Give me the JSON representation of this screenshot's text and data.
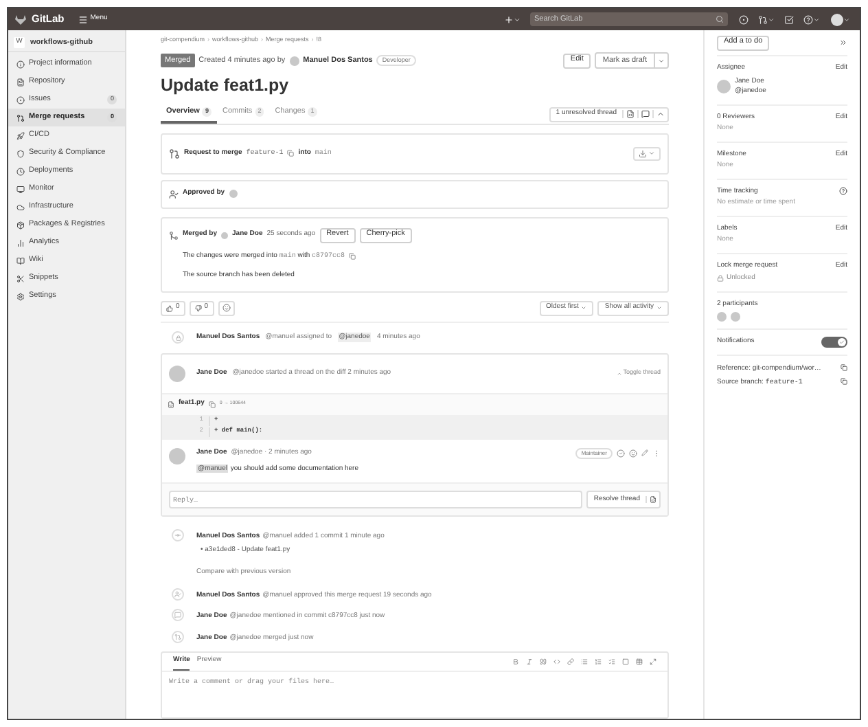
{
  "topbar": {
    "logo": "GitLab",
    "menu": "Menu",
    "search": {
      "placeholder": "Search GitLab"
    }
  },
  "sidebar": {
    "project": {
      "initial": "W",
      "name": "workflows-github"
    },
    "items": [
      {
        "label": "Project information",
        "selected": false
      },
      {
        "label": "Repository",
        "selected": false
      },
      {
        "label": "Issues",
        "badge": "0",
        "selected": false
      },
      {
        "label": "Merge requests",
        "badge": "0",
        "selected": true
      },
      {
        "label": "CI/CD",
        "selected": false
      },
      {
        "label": "Security & Compliance",
        "selected": false
      },
      {
        "label": "Deployments",
        "selected": false
      },
      {
        "label": "Monitor",
        "selected": false
      },
      {
        "label": "Infrastructure",
        "selected": false
      },
      {
        "label": "Packages & Registries",
        "selected": false
      },
      {
        "label": "Analytics",
        "selected": false
      },
      {
        "label": "Wiki",
        "selected": false
      },
      {
        "label": "Snippets",
        "selected": false
      },
      {
        "label": "Settings",
        "selected": false
      }
    ]
  },
  "breadcrumbs": {
    "separator": "›",
    "items": [
      "git-compendium",
      "workflows-github",
      "Merge requests",
      "!8"
    ]
  },
  "header": {
    "status": "Merged",
    "created": "Created 4 minutes ago by",
    "author": "Manuel Dos Santos",
    "role": "Developer",
    "buttons": [
      "Edit",
      "Mark as draft"
    ],
    "title": "Update feat1.py"
  },
  "tabs": [
    {
      "label": "Overview",
      "count": "9",
      "selected": true
    },
    {
      "label": "Commits",
      "count": "2",
      "selected": false
    },
    {
      "label": "Changes",
      "count": "1",
      "selected": false
    }
  ],
  "threads": "1 unresolved thread",
  "request": {
    "label": "Request to merge",
    "source": "feature-1",
    "into": "into",
    "target": "main"
  },
  "approval": {
    "label": "Approved by"
  },
  "merged": {
    "label": "Merged by",
    "user": "Jane Doe",
    "time": "25 seconds ago",
    "buttons": [
      "Revert",
      "Cherry-pick"
    ],
    "text": "The changes were merged into",
    "branch": "main",
    "with": "with",
    "commit": "c8797cc8",
    "deleted": "The source branch has been deleted"
  },
  "reactions": [
    {
      "kind": "up",
      "count": "0"
    },
    {
      "kind": "down",
      "count": "0"
    }
  ],
  "sort": [
    "Oldest first",
    "Show all activity"
  ],
  "assigned": {
    "author": "Manuel Dos Santos",
    "handle": "@manuel",
    "text": "assigned to",
    "mention": "@janedoe",
    "time": "4 minutes ago"
  },
  "thread": {
    "author": "Jane Doe",
    "handle": "@janedoe",
    "text": "started a thread on the diff 2 minutes ago",
    "toggle": "Toggle thread",
    "file": "feat1.py",
    "mode": "0 → 100644",
    "lines": [
      {
        "number": "1",
        "code": "+"
      },
      {
        "number": "2",
        "code": "+ def main():"
      }
    ],
    "comment": {
      "author": "Jane Doe",
      "meta": "@janedoe · 2 minutes ago",
      "role": "Maintainer",
      "mention": "@manuel",
      "text": "you should add some documentation here"
    },
    "reply": {
      "placeholder": "Reply…"
    },
    "resolve": "Resolve thread"
  },
  "events": [
    {
      "kind": "commit",
      "author": "Manuel Dos Santos",
      "text": "@manuel added 1 commit 1 minute ago",
      "commit": "• a3e1ded8 - Update feat1.py",
      "link": "Compare with previous version"
    },
    {
      "kind": "approved",
      "author": "Manuel Dos Santos",
      "text": "@manuel approved this merge request 19 seconds ago"
    },
    {
      "kind": "mention",
      "author": "Jane Doe",
      "text": "@janedoe mentioned in commit c8797cc8 just now"
    },
    {
      "kind": "merged",
      "author": "Jane Doe",
      "text": "@janedoe merged just now"
    }
  ],
  "editor": {
    "tabs": [
      {
        "label": "Write",
        "selected": true
      },
      {
        "label": "Preview",
        "selected": false
      }
    ],
    "placeholder": "Write a comment or drag your files here…"
  },
  "right": {
    "todo": "Add a to do",
    "sections": [
      {
        "kind": "assignee",
        "title": "Assignee",
        "action": "Edit",
        "name": "Jane Doe",
        "handle": "@janedoe"
      },
      {
        "kind": "plain",
        "title": "0 Reviewers",
        "action": "Edit",
        "value": "None"
      },
      {
        "kind": "plain",
        "title": "Milestone",
        "action": "Edit",
        "value": "None"
      },
      {
        "kind": "help",
        "title": "Time tracking",
        "value": "No estimate or time spent"
      },
      {
        "kind": "plain",
        "title": "Labels",
        "action": "Edit",
        "value": "None"
      },
      {
        "kind": "lock",
        "title": "Lock merge request",
        "action": "Edit",
        "value": "Unlocked"
      },
      {
        "kind": "participants",
        "title": "2 participants"
      },
      {
        "kind": "toggle",
        "title": "Notifications",
        "on": true
      }
    ],
    "reference": {
      "label": "Reference:",
      "value": "git-compendium/wor…"
    },
    "source": {
      "label": "Source branch:",
      "value": "feature-1"
    }
  }
}
